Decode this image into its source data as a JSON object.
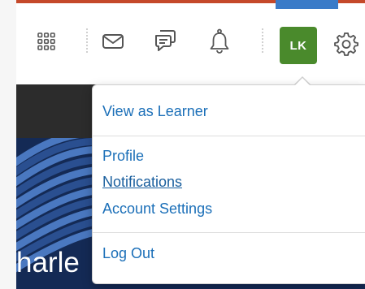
{
  "header": {
    "avatar_initials": "LK",
    "icons": [
      "apps-grid-icon",
      "mail-icon",
      "chat-icon",
      "bell-icon",
      "gear-icon"
    ]
  },
  "hero": {
    "name_fragment": "harle"
  },
  "user_menu": {
    "view_as_learner": "View as Learner",
    "profile": "Profile",
    "notifications": "Notifications",
    "account_settings": "Account Settings",
    "log_out": "Log Out"
  },
  "colors": {
    "accent_top": "#c5492a",
    "avatar_bg": "#4a8a2c",
    "link": "#1b6fb8",
    "active_tab": "#3a7bc8"
  }
}
